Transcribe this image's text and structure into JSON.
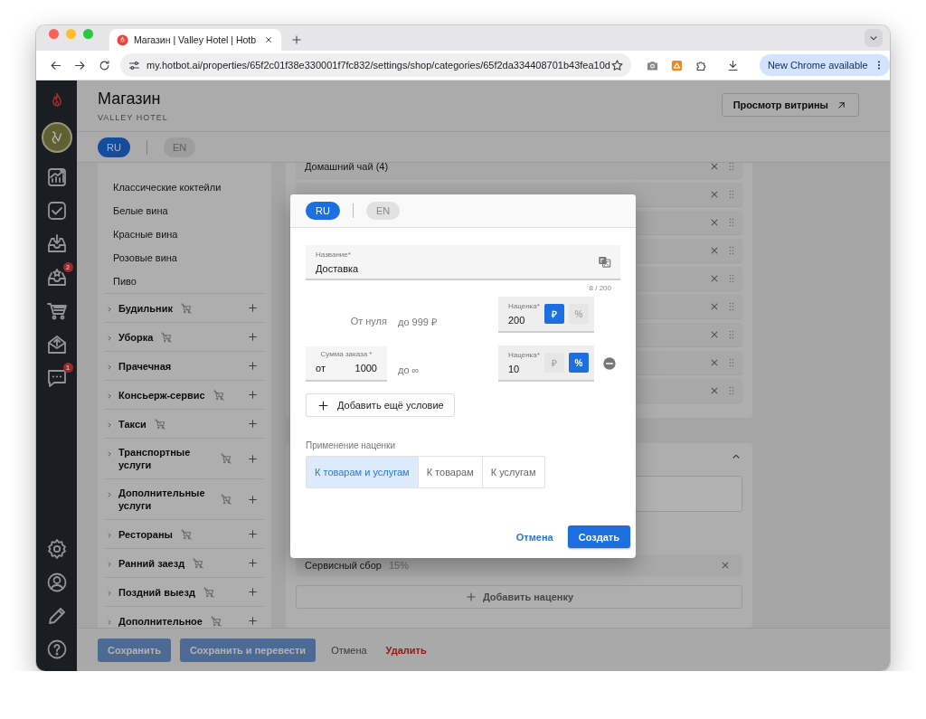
{
  "browser": {
    "tab_title": "Магазин | Valley Hotel | Hotb",
    "url": "my.hotbot.ai/properties/65f2c01f38e330001f7fc832/settings/shop/categories/65f2da334408701b43fea10d",
    "update_button": "New Chrome available"
  },
  "rail": {
    "inbox_badge": "2",
    "chat_badge": "1"
  },
  "header": {
    "title": "Магазин",
    "subtitle": "VALLEY HOTEL",
    "storefront_button": "Просмотр витрины"
  },
  "languages": [
    {
      "label": "RU",
      "selected": true
    },
    {
      "label": "EN",
      "selected": false
    }
  ],
  "categories": {
    "subitems": [
      "Классические коктейли",
      "Белые вина",
      "Красные вина",
      "Розовые вина",
      "Пиво"
    ],
    "groups": [
      {
        "name": "Будильник",
        "shop_hidden": true
      },
      {
        "name": "Уборка",
        "shop_hidden": true
      },
      {
        "name": "Прачечная",
        "shop_hidden": false
      },
      {
        "name": "Консьерж-сервис",
        "shop_hidden": true
      },
      {
        "name": "Такси",
        "shop_hidden": true
      },
      {
        "name": "Транспортные услуги",
        "shop_hidden": true
      },
      {
        "name": "Дополнительные услуги",
        "shop_hidden": true
      },
      {
        "name": "Рестораны",
        "shop_hidden": true
      },
      {
        "name": "Ранний заезд",
        "shop_hidden": true
      },
      {
        "name": "Поздний выезд",
        "shop_hidden": true
      },
      {
        "name": "Дополнительное",
        "shop_hidden": true
      }
    ]
  },
  "products_card": {
    "rows": [
      {
        "name": "Домашний чай (4)"
      },
      {},
      {},
      {},
      {},
      {},
      {},
      {},
      {}
    ]
  },
  "markup_card": {
    "expanded": true,
    "markups": [
      {
        "name": "Сервисный сбор",
        "value": "15%"
      }
    ],
    "add_button": "Добавить наценку"
  },
  "footer": [
    {
      "label": "Сохранить",
      "kind": "primary",
      "disabled": true
    },
    {
      "label": "Сохранить и перевести",
      "kind": "primary",
      "disabled": true
    },
    {
      "label": "Отмена",
      "kind": "text"
    },
    {
      "label": "Удалить",
      "kind": "danger"
    }
  ],
  "dialog": {
    "languages": [
      {
        "label": "RU",
        "selected": true
      },
      {
        "label": "EN",
        "selected": false
      }
    ],
    "name_field": {
      "label": "Название*",
      "value": "Доставка",
      "counter": "8 / 200"
    },
    "conditions": [
      {
        "kind": "base",
        "from_text": "От нуля",
        "to_text": "до 999 ₽",
        "markup_label": "Наценка*",
        "markup_value": "200",
        "removable": false,
        "units": [
          {
            "label": "₽",
            "selected": true
          },
          {
            "label": "%",
            "selected": false
          }
        ]
      },
      {
        "kind": "range",
        "amount_label": "Сумма заказа *",
        "from_prefix": "от",
        "from_value": "1000",
        "to_text": "до ∞",
        "markup_label": "Наценка*",
        "markup_value": "10",
        "removable": true,
        "units": [
          {
            "label": "₽",
            "selected": false
          },
          {
            "label": "%",
            "selected": true
          }
        ]
      }
    ],
    "add_condition": "Добавить ещё условие",
    "apply_label": "Применение наценки",
    "apply_options": [
      {
        "label": "К товарам и услугам",
        "selected": true
      },
      {
        "label": "К товарам",
        "selected": false
      },
      {
        "label": "К услугам",
        "selected": false
      }
    ],
    "cancel": "Отмена",
    "submit": "Создать"
  }
}
